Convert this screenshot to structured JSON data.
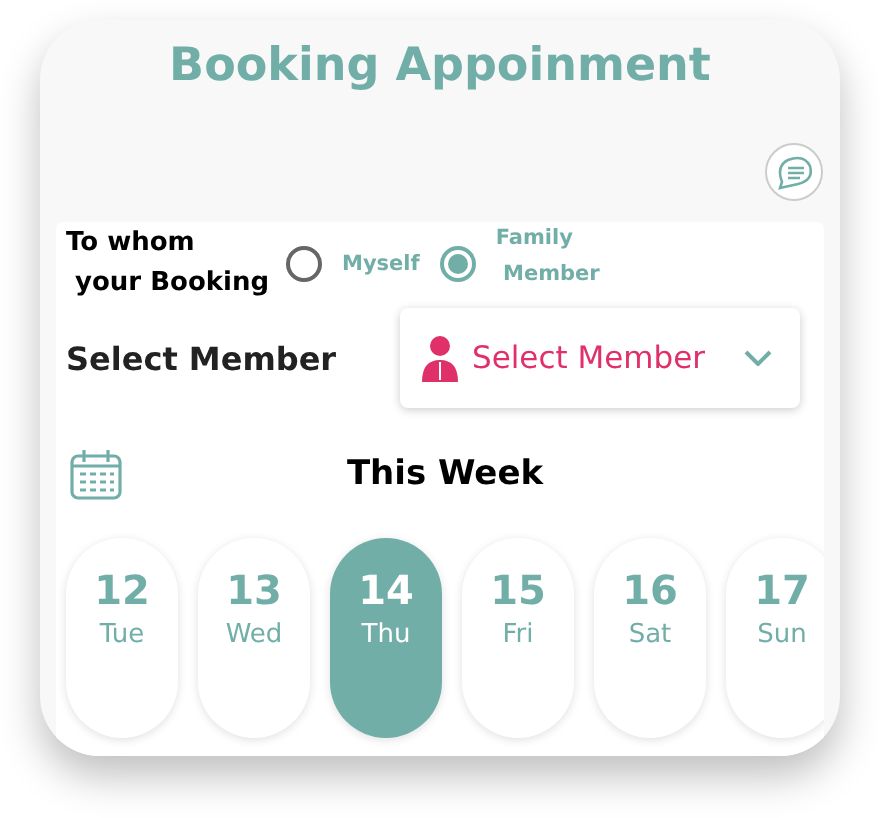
{
  "title": "Booking Appoinment",
  "booking_for": {
    "label": "To whom\n your Booking",
    "options": [
      {
        "label": "Myself",
        "selected": false
      },
      {
        "label": "Family\n Member",
        "selected": true
      }
    ]
  },
  "member": {
    "label": "Select Member",
    "placeholder": "Select Member"
  },
  "week": {
    "title": "This Week",
    "days": [
      {
        "date": "12",
        "weekday": "Tue",
        "selected": false
      },
      {
        "date": "13",
        "weekday": "Wed",
        "selected": false
      },
      {
        "date": "14",
        "weekday": "Thu",
        "selected": true
      },
      {
        "date": "15",
        "weekday": "Fri",
        "selected": false
      },
      {
        "date": "16",
        "weekday": "Sat",
        "selected": false
      },
      {
        "date": "17",
        "weekday": "Sun",
        "selected": false
      }
    ]
  }
}
